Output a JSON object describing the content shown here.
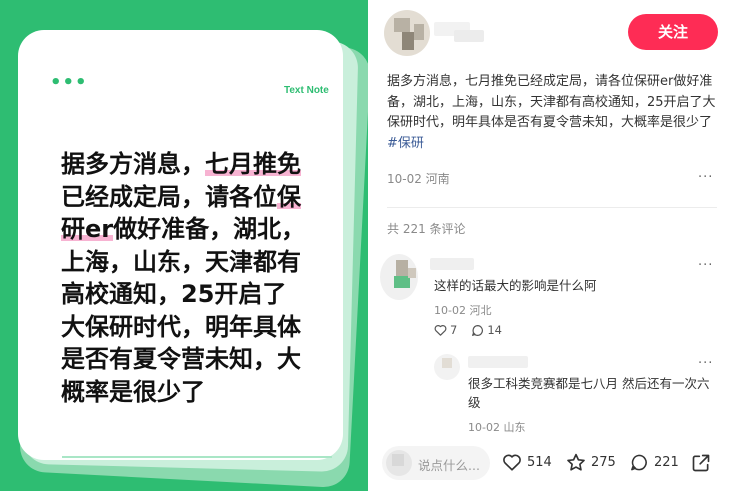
{
  "card": {
    "dots": "•••",
    "tag": "Text Note",
    "lines": [
      {
        "pre": "据多方消息，",
        "hl": "七月推免",
        "post": ""
      },
      {
        "pre": "已经成定局，请各位",
        "hl": "保",
        "post": ""
      },
      {
        "pre": "",
        "hl": "研er",
        "post": "做好准备，湖北，"
      },
      {
        "pre": "上海，山东，天津都有",
        "hl": "",
        "post": ""
      },
      {
        "pre": "高校通知，25开启了",
        "hl": "",
        "post": ""
      },
      {
        "pre": "大保研时代，明年具体",
        "hl": "",
        "post": ""
      },
      {
        "pre": "是否有夏令营未知，大",
        "hl": "",
        "post": ""
      },
      {
        "pre": "概率是很少了",
        "hl": "",
        "post": ""
      }
    ]
  },
  "header": {
    "follow_label": "关注"
  },
  "post": {
    "text": "据多方消息，七月推免已经成定局，请各位保研er做好准备，湖北，上海，山东，天津都有高校通知，25开启了大保研时代，明年具体是否有夏令营未知，大概率是很少了 ",
    "tag": "#保研",
    "meta": "10-02 河南",
    "more": "···"
  },
  "comments": {
    "count_label": "共 221 条评论",
    "items": [
      {
        "text": "这样的话最大的影响是什么阿",
        "meta": "10-02 河北",
        "likes": "7",
        "replies": "14",
        "more": "···"
      },
      {
        "text": "很多工科类竞赛都是七八月 然后还有一次六级",
        "meta": "10-02 山东",
        "more": "···"
      }
    ]
  },
  "bottom_bar": {
    "placeholder": "说点什么...",
    "likes": "514",
    "favorites": "275",
    "comments": "221"
  },
  "colors": {
    "brand_green": "#2ebd72",
    "follow_red": "#fe2c55",
    "highlight_pink": "#f7b3d2",
    "tag_blue": "#3b5b96"
  }
}
